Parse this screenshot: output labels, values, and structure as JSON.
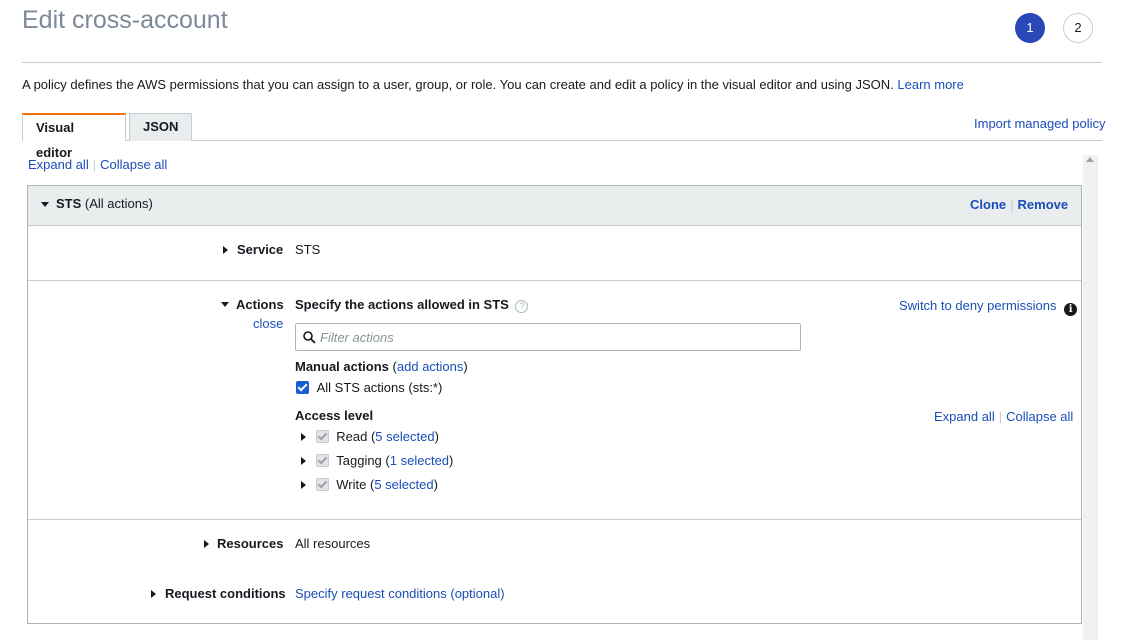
{
  "page": {
    "title": "Edit cross-account",
    "steps": [
      "1",
      "2"
    ],
    "description": "A policy defines the AWS permissions that you can assign to a user, group, or role. You can create and edit a policy in the visual editor and using JSON.",
    "learn_more": "Learn more"
  },
  "tabs": [
    {
      "label": "Visual editor",
      "active": true
    },
    {
      "label": "JSON",
      "active": false
    }
  ],
  "import_label": "Import managed policy",
  "expand_all": "Expand all",
  "collapse_all": "Collapse all",
  "statement": {
    "service_name": "STS",
    "service_suffix": "(All actions)",
    "clone": "Clone",
    "remove": "Remove",
    "service": {
      "label": "Service",
      "value": "STS"
    },
    "actions": {
      "label": "Actions",
      "close": "close",
      "heading": "Specify the actions allowed in STS",
      "deny_switch": "Switch to deny permissions",
      "filter_placeholder": "Filter actions",
      "manual_label": "Manual actions",
      "add_actions": "add actions",
      "all_actions_label": "All STS actions (sts:*)",
      "access_level_label": "Access level",
      "expand_all": "Expand all",
      "collapse_all": "Collapse all",
      "levels": [
        {
          "name": "Read",
          "selected": "5 selected"
        },
        {
          "name": "Tagging",
          "selected": "1 selected"
        },
        {
          "name": "Write",
          "selected": "5 selected"
        }
      ]
    },
    "resources": {
      "label": "Resources",
      "value": "All resources"
    },
    "conditions": {
      "label": "Request conditions",
      "value": "Specify request conditions (optional)"
    }
  },
  "icons": {
    "step_active_color": "#2a48b8",
    "tab_accent_color": "#ec7211",
    "link_color": "#1a4eb8"
  }
}
